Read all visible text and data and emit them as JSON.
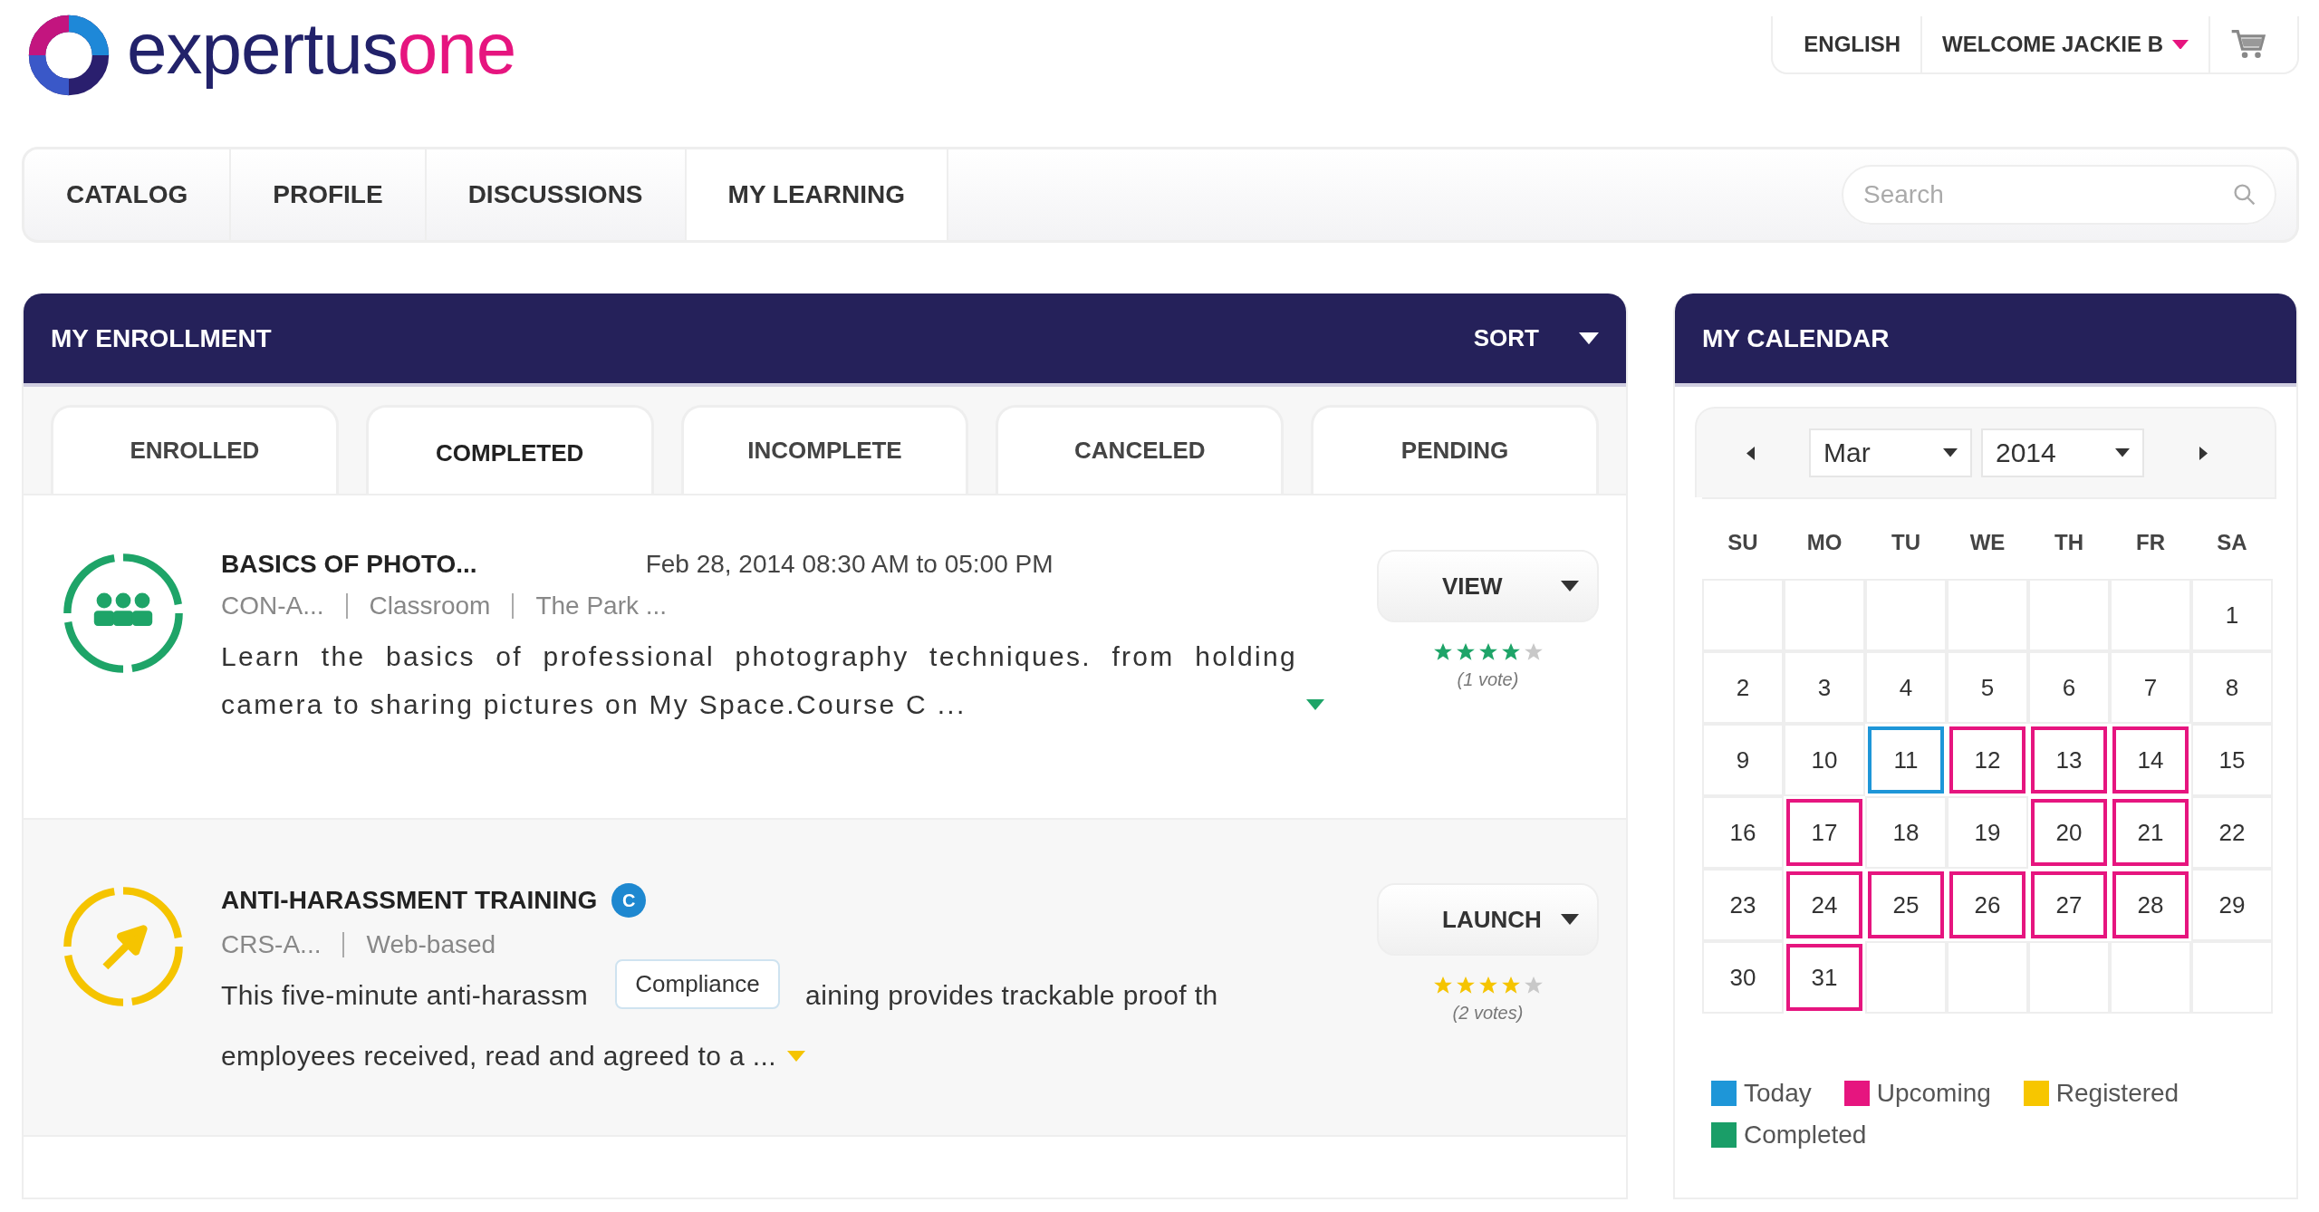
{
  "logo": {
    "parts": [
      "expertus",
      "one"
    ]
  },
  "top_bar": {
    "language": "ENGLISH",
    "user_menu": "WELCOME JACKIE B"
  },
  "nav": {
    "tabs": [
      {
        "label": "CATALOG",
        "selected": false
      },
      {
        "label": "PROFILE",
        "selected": false
      },
      {
        "label": "DISCUSSIONS",
        "selected": false
      },
      {
        "label": "MY LEARNING",
        "selected": true
      }
    ],
    "search": {
      "placeholder": "Search"
    }
  },
  "enrollment": {
    "title": "MY ENROLLMENT",
    "sort": "SORT",
    "tabs": [
      {
        "label": "ENROLLED",
        "selected": false
      },
      {
        "label": "COMPLETED",
        "selected": true
      },
      {
        "label": "INCOMPLETE",
        "selected": false
      },
      {
        "label": "CANCELED",
        "selected": false
      },
      {
        "label": "PENDING",
        "selected": false
      }
    ],
    "items": [
      {
        "kind": "classroom",
        "color": "#1ea468",
        "title": "BASICS OF PHOTO...",
        "date": "Feb 28, 2014 08:30 AM to 05:00 PM",
        "meta": [
          "CON-A...",
          "Classroom",
          "The Park ..."
        ],
        "description": [
          "Learn the basics of professional photography techniques. from holding camera to sharing pictures on My Space.Course C ..."
        ],
        "action": "VIEW",
        "stars": 4,
        "votes": "(1 vote)"
      },
      {
        "kind": "web",
        "color": "#f5c400",
        "title": "ANTI-HARASSMENT TRAINING",
        "badge": "C",
        "tooltip": "Compliance",
        "meta": [
          "CRS-A...",
          "Web-based"
        ],
        "description": [
          "This five-minute anti-harassm",
          "aining provides trackable proof th",
          "employees received, read and agreed to a ..."
        ],
        "action": "LAUNCH",
        "stars": 4,
        "votes": "(2 votes)"
      }
    ]
  },
  "calendar": {
    "title": "MY CALENDAR",
    "month": "Mar",
    "year": "2014",
    "weekdays": [
      "SU",
      "MO",
      "TU",
      "WE",
      "TH",
      "FR",
      "SA"
    ],
    "weeks": [
      [
        {
          "kind": "blank"
        },
        {
          "kind": "blank"
        },
        {
          "kind": "blank"
        },
        {
          "kind": "blank"
        },
        {
          "kind": "blank"
        },
        {
          "kind": "blank"
        },
        {
          "kind": "day",
          "day": "1"
        }
      ],
      [
        {
          "kind": "day",
          "day": "2"
        },
        {
          "kind": "day",
          "day": "3"
        },
        {
          "kind": "day",
          "day": "4"
        },
        {
          "kind": "day",
          "day": "5"
        },
        {
          "kind": "day",
          "day": "6"
        },
        {
          "kind": "day",
          "day": "7"
        },
        {
          "kind": "day",
          "day": "8"
        }
      ],
      [
        {
          "kind": "day",
          "day": "9"
        },
        {
          "kind": "day",
          "day": "10"
        },
        {
          "kind": "day",
          "day": "11",
          "color": "#1e96d8"
        },
        {
          "kind": "day",
          "day": "12",
          "color": "#e6157f"
        },
        {
          "kind": "day",
          "day": "13",
          "color": "#e6157f"
        },
        {
          "kind": "day",
          "day": "14",
          "color": "#e6157f"
        },
        {
          "kind": "day",
          "day": "15"
        }
      ],
      [
        {
          "kind": "day",
          "day": "16"
        },
        {
          "kind": "day",
          "day": "17",
          "color": "#e6157f"
        },
        {
          "kind": "day",
          "day": "18"
        },
        {
          "kind": "day",
          "day": "19"
        },
        {
          "kind": "day",
          "day": "20",
          "color": "#e6157f"
        },
        {
          "kind": "day",
          "day": "21",
          "color": "#e6157f"
        },
        {
          "kind": "day",
          "day": "22"
        }
      ],
      [
        {
          "kind": "day",
          "day": "23"
        },
        {
          "kind": "day",
          "day": "24",
          "color": "#e6157f"
        },
        {
          "kind": "day",
          "day": "25",
          "color": "#e6157f"
        },
        {
          "kind": "day",
          "day": "26",
          "color": "#e6157f"
        },
        {
          "kind": "day",
          "day": "27",
          "color": "#e6157f"
        },
        {
          "kind": "day",
          "day": "28",
          "color": "#e6157f"
        },
        {
          "kind": "day",
          "day": "29"
        }
      ],
      [
        {
          "kind": "day",
          "day": "30"
        },
        {
          "kind": "day",
          "day": "31",
          "color": "#e6157f"
        },
        {
          "kind": "blank"
        },
        {
          "kind": "blank"
        },
        {
          "kind": "blank"
        },
        {
          "kind": "blank"
        },
        {
          "kind": "blank"
        }
      ]
    ],
    "legend": [
      {
        "label": "Today",
        "color": "#1e96d8"
      },
      {
        "label": "Upcoming",
        "color": "#e6157f"
      },
      {
        "label": "Registered",
        "color": "#f7c600"
      },
      {
        "label": "Completed",
        "color": "#1a9e68"
      }
    ]
  }
}
